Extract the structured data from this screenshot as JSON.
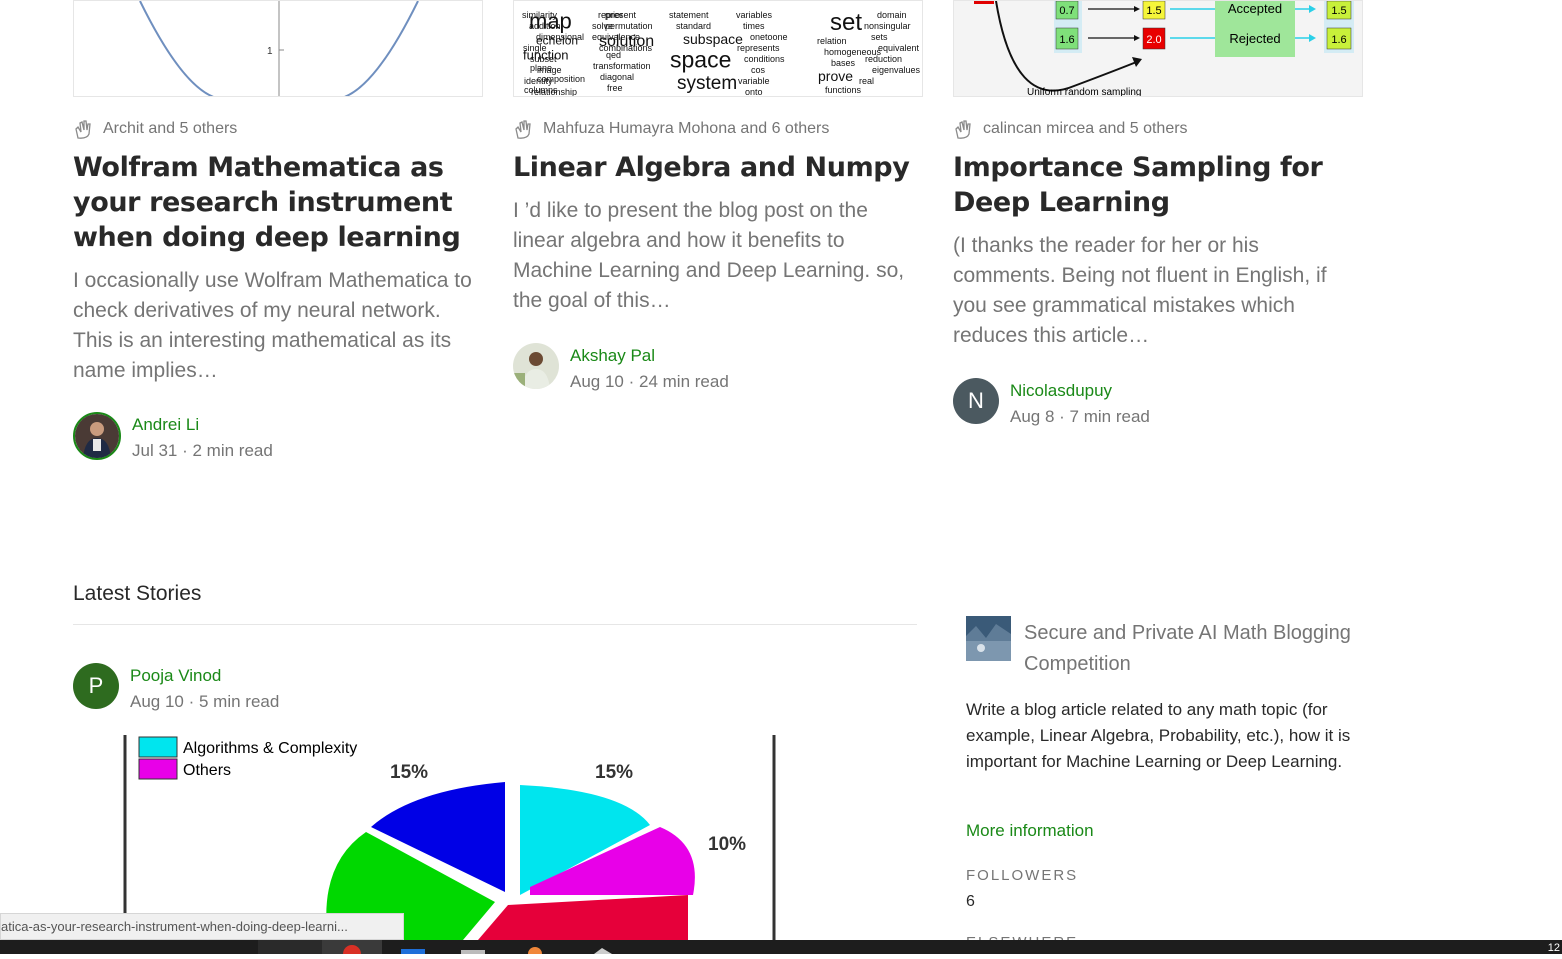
{
  "cards": [
    {
      "claps": "Archit and 5 others",
      "title": "Wolfram Mathematica as your research instrument when doing deep learning",
      "excerpt": "I occasionally use Wolfram Mathematica to check derivatives of my neural network. This is an interesting mathematical as its name implies…",
      "author": "Andrei Li",
      "date": "Jul 31",
      "read": "2 min read",
      "thumb_label": "1"
    },
    {
      "claps": "Mahfuza Humayra Mohona and 6 others",
      "title": "Linear Algebra and Numpy",
      "excerpt": "I ’d like to present the blog post on the linear algebra and how it benefits to Machine Learning and Deep Learning. so, the goal of this…",
      "author": "Akshay Pal",
      "date": "Aug 10",
      "read": "24 min read",
      "cloud_words": [
        "similarity",
        "addition",
        "dimensional",
        "single",
        "subset",
        "image",
        "identity",
        "relationship",
        "prior",
        "solve",
        "solution",
        "qed",
        "transformation",
        "diagonal",
        "free",
        "statement",
        "standard",
        "subspace",
        "space",
        "system",
        "variables",
        "times",
        "onetoone",
        "represents",
        "conditions",
        "cos",
        "variable",
        "onto",
        "set",
        "relation",
        "homogeneous",
        "bases",
        "prove",
        "functions",
        "domain",
        "nonsingular",
        "sets",
        "equivalent",
        "reduction",
        "eigenvalues",
        "real",
        "map",
        "echelon",
        "function",
        "plane",
        "composition",
        "columns",
        "represent",
        "permutation",
        "equivalence",
        "combinations"
      ]
    },
    {
      "claps": "calincan mircea and 5 others",
      "title": "Importance Sampling for Deep Learning",
      "excerpt": "(I thanks the reader for her or his comments. Being not fluent in English, if you see grammatical mistakes which reduces this article…",
      "author": "Nicolasdupuy",
      "author_initial": "N",
      "date": "Aug 8",
      "read": "7 min read",
      "diagram": {
        "left_vals": [
          "0.7",
          "1.6"
        ],
        "mid_vals": [
          "1.5",
          "2.0"
        ],
        "accepted": "Accepted",
        "rejected": "Rejected",
        "right_vals": [
          "1.5",
          "1.6"
        ],
        "caption": "Uniform random sampling"
      }
    }
  ],
  "latest": {
    "heading": "Latest Stories",
    "post": {
      "author": "Pooja Vinod",
      "author_initial": "P",
      "date": "Aug 10",
      "read": "5 min read"
    }
  },
  "chart_data": {
    "type": "pie",
    "legend": [
      "Algorithms & Complexity",
      "Others"
    ],
    "slice_labels": [
      "15%",
      "15%",
      "10%"
    ],
    "colors": [
      "#00e5ee",
      "#e800e8",
      "#0000e6",
      "#00d800",
      "#e6003a"
    ]
  },
  "publication": {
    "name": "Secure and Private AI Math Blogging Competition",
    "description": "Write a blog article related to any math topic (for example, Linear Algebra, Probability, etc.), how it is important for Machine Learning or Deep Learning.",
    "more": "More information",
    "followers_label": "FOLLOWERS",
    "followers_value": "6",
    "elsewhere_label": "ELSEWHERE"
  },
  "status_bar_url": "atica-as-your-research-instrument-when-doing-deep-learni...",
  "taskbar_clock": "12",
  "colors": {
    "accent": "#1a8917",
    "text": "#292929",
    "muted": "#757575"
  }
}
